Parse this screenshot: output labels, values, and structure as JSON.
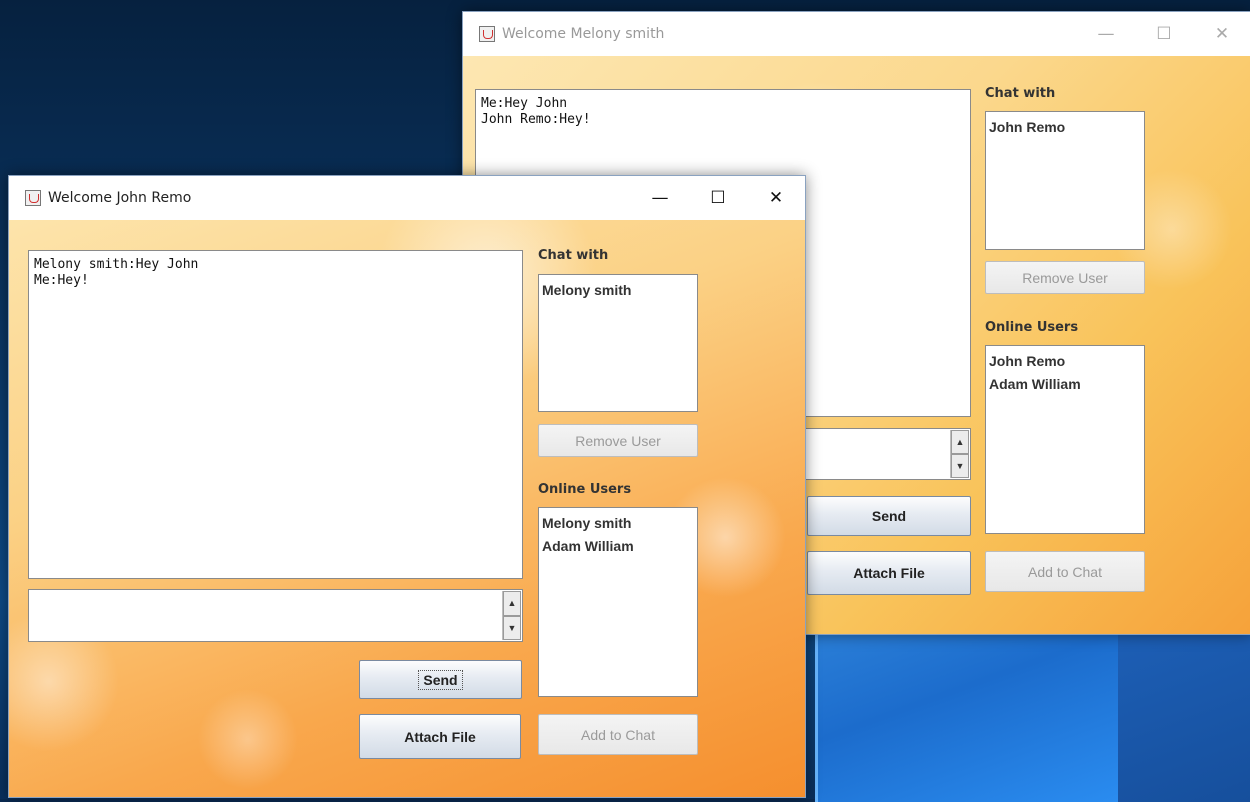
{
  "melony_window": {
    "title": "Welcome Melony smith",
    "controls": {
      "minimize": "—",
      "maximize": "☐",
      "close": "✕"
    },
    "chat_log": "Me:Hey John\nJohn Remo:Hey!",
    "message_input": "",
    "chat_with_label": "Chat with",
    "chat_with_list": [
      "John Remo"
    ],
    "remove_user_label": "Remove User",
    "online_users_label": "Online Users",
    "online_users_list": [
      "John Remo",
      "Adam William"
    ],
    "send_label": "Send",
    "attach_file_label": "Attach File",
    "add_to_chat_label": "Add to Chat"
  },
  "john_window": {
    "title": "Welcome John Remo",
    "controls": {
      "minimize": "—",
      "maximize": "☐",
      "close": "✕"
    },
    "chat_log": "Melony smith:Hey John\nMe:Hey!",
    "message_input": "",
    "chat_with_label": "Chat with",
    "chat_with_list": [
      "Melony smith"
    ],
    "remove_user_label": "Remove User",
    "online_users_label": "Online Users",
    "online_users_list": [
      "Melony smith",
      "Adam William"
    ],
    "send_label": "Send",
    "attach_file_label": "Attach File",
    "add_to_chat_label": "Add to Chat"
  },
  "spinner": {
    "up": "▲",
    "down": "▼"
  },
  "icons": [
    "java-app-icon",
    "minimize-icon",
    "maximize-icon",
    "close-icon"
  ]
}
